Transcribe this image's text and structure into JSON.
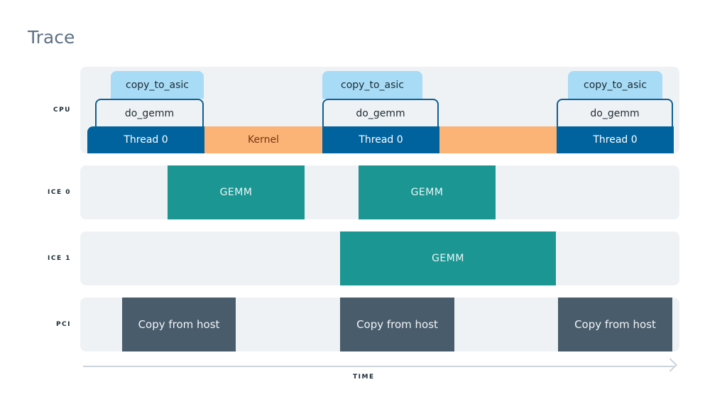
{
  "title": "Trace",
  "axis": {
    "label": "TIME"
  },
  "lanes": [
    {
      "label": "CPU"
    },
    {
      "label": "ICE 0"
    },
    {
      "label": "ICE 1"
    },
    {
      "label": "PCI"
    }
  ],
  "events": {
    "cpu_thread": [
      "Thread 0",
      "Thread 0",
      "Thread 0"
    ],
    "cpu_kernel": [
      "Kernel",
      ""
    ],
    "cpu_do_gemm": [
      "do_gemm",
      "do_gemm",
      "do_gemm"
    ],
    "cpu_copy_to_asic": [
      "copy_to_asic",
      "copy_to_asic",
      "copy_to_asic"
    ],
    "ice0": [
      "GEMM",
      "GEMM"
    ],
    "ice1": [
      "GEMM"
    ],
    "pci": [
      "Copy from host",
      "Copy from host",
      "Copy from host"
    ]
  },
  "colors": {
    "thread": "#00639e",
    "kernel": "#fbb476",
    "copy_to_asic": "#a7dbf6",
    "do_gemm_border": "#0f5e93",
    "gemm": "#1b9693",
    "pci_copy": "#495c6b",
    "track": "#eff2f5"
  }
}
